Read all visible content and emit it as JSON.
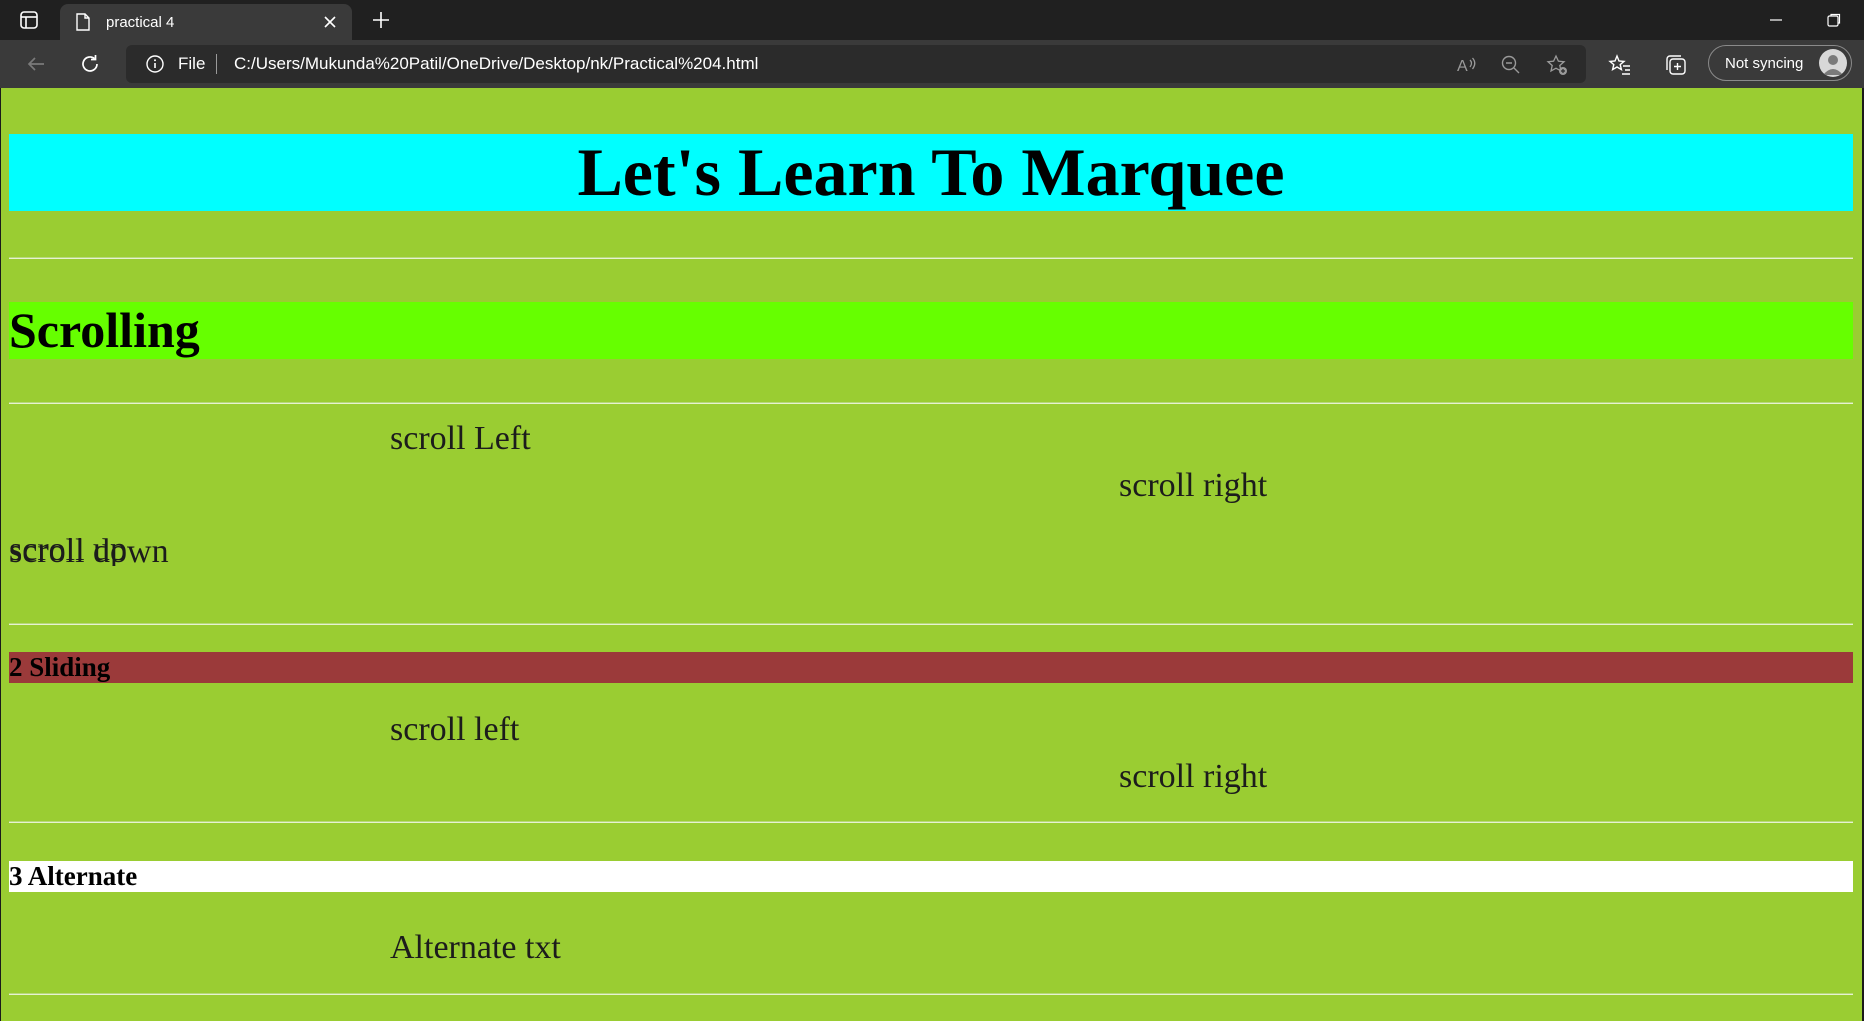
{
  "browser": {
    "tab_title": "practical 4",
    "address_prefix": "File",
    "url": "C:/Users/Mukunda%20Patil/OneDrive/Desktop/nk/Practical%204.html",
    "profile_label": "Not syncing"
  },
  "page": {
    "background_color": "#9acd32",
    "heading": {
      "text": "Let's Learn To Marquee",
      "color": "#00ffff"
    },
    "scrolling": {
      "heading": {
        "text": "Scrolling",
        "color": "#66ff00"
      },
      "items": {
        "left": "scroll Left",
        "right": "scroll right",
        "up": "scroll up",
        "down": "scroll down"
      }
    },
    "sliding": {
      "heading": {
        "text": "2 Sliding",
        "color": "#9b3a3a"
      },
      "items": {
        "left": "scroll left",
        "right": "scroll right"
      }
    },
    "alternate": {
      "heading": {
        "text": "3 Alternate",
        "color": "#ffffff"
      },
      "items": {
        "text": "Alternate txt"
      }
    }
  }
}
